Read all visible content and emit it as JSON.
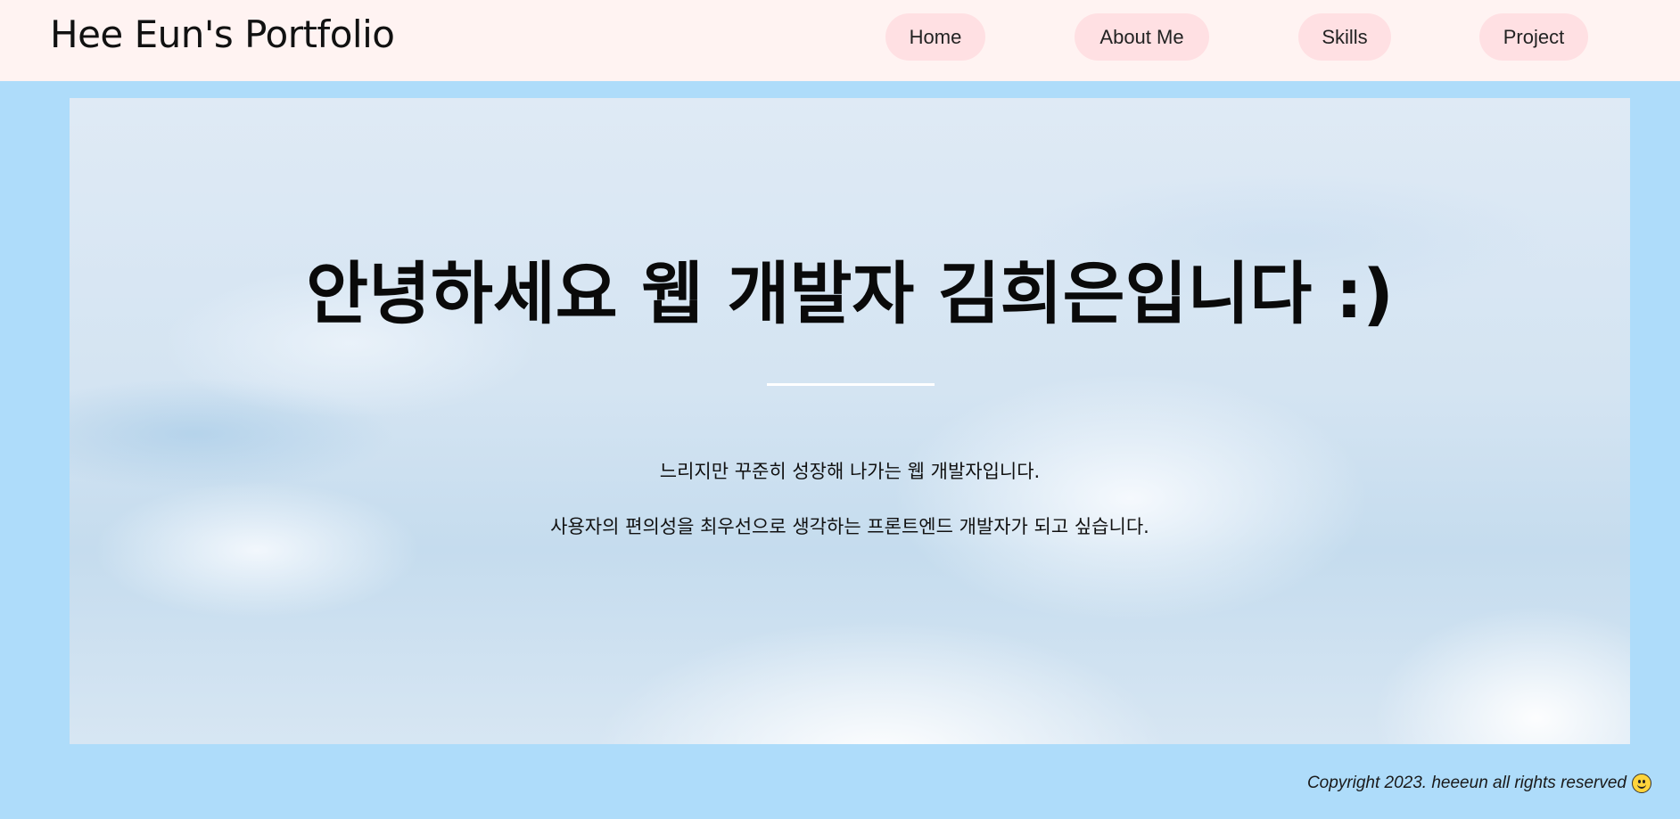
{
  "header": {
    "logo": "Hee Eun's Portfolio",
    "nav": [
      "Home",
      "About Me",
      "Skills",
      "Project"
    ]
  },
  "hero": {
    "title": "안녕하세요 웹 개발자 김희은입니다 :)",
    "subtitle_line1": "느리지만 꾸준히 성장해 나가는 웹 개발자입니다.",
    "subtitle_line2": "사용자의 편의성을 최우선으로 생각하는 프론트엔드 개발자가 되고 싶습니다."
  },
  "footer": {
    "copyright": "Copyright 2023. heeeun all rights reserved"
  },
  "colors": {
    "page_background": "#aedcfa",
    "header_background": "#fff3f2",
    "nav_button_background": "#ffe0e3"
  },
  "icons": {
    "footer_emoji": "smiling-face-icon"
  }
}
